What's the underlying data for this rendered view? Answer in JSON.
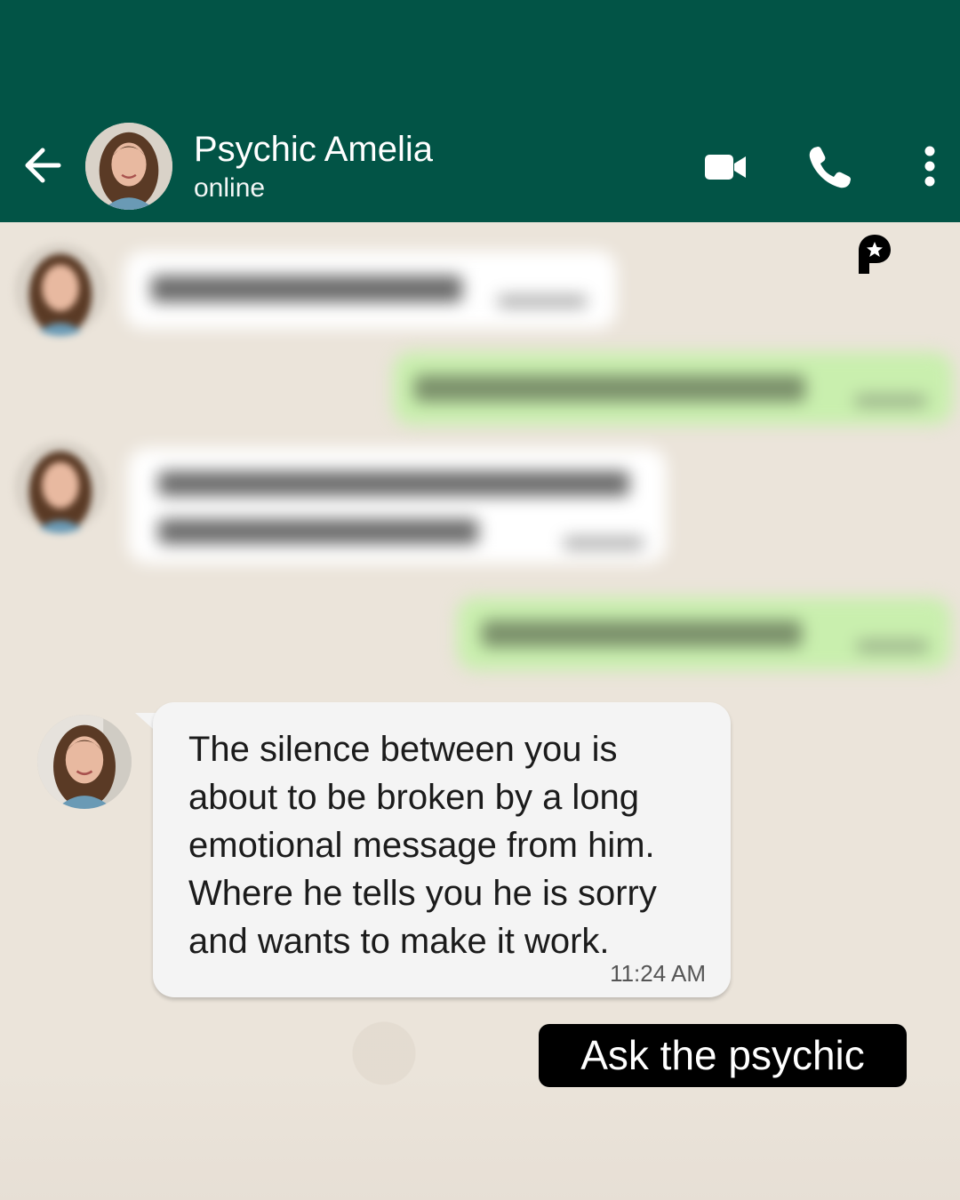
{
  "header": {
    "contact_name": "Psychic Amelia",
    "status": "online",
    "icons": [
      "back-arrow-icon",
      "avatar",
      "video-call-icon",
      "phone-icon",
      "more-vert-icon"
    ]
  },
  "colors": {
    "header_bg": "#025446",
    "chat_bg": "#ebe4da",
    "incoming_bubble": "#f4f4f4",
    "outgoing_bubble": "#c9efae",
    "cta_bg": "#000000"
  },
  "messages": [
    {
      "direction": "incoming",
      "text": "The silence between you is about to be broken by a long emotional message from him. Where he tells you he is sorry and wants to make it work.",
      "lines": [
        "The silence between you is",
        "about to be broken by a long",
        "emotional message from him.",
        "Where he tells you he is sorry",
        "and wants to make it work."
      ],
      "time": "11:24 AM"
    }
  ],
  "cta": {
    "label": "Ask the psychic"
  }
}
